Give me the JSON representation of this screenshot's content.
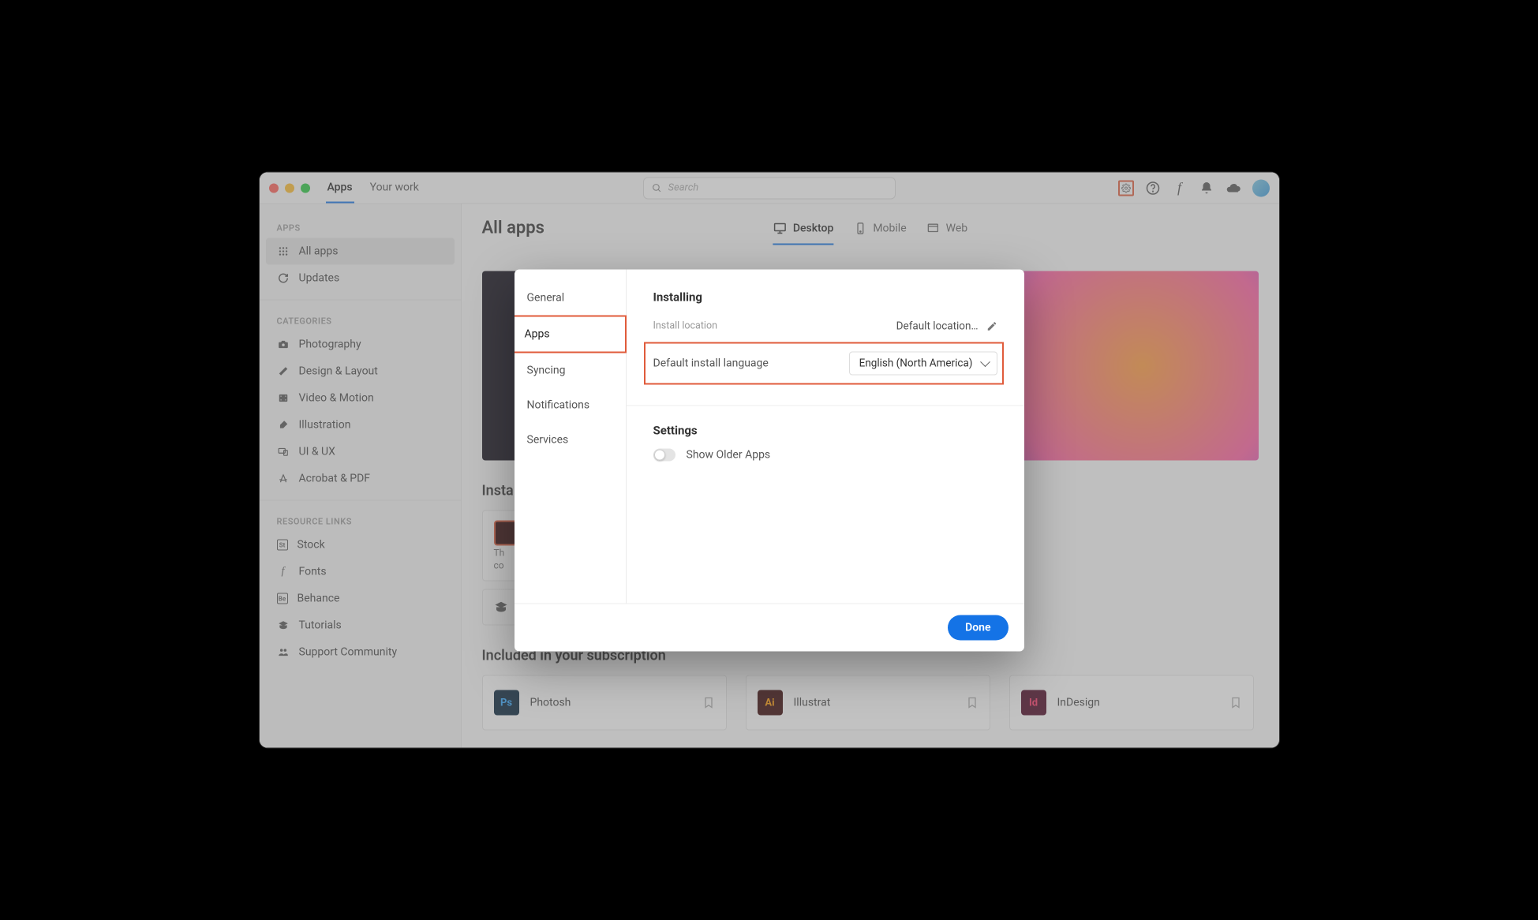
{
  "header": {
    "tabs": [
      "Apps",
      "Your work"
    ],
    "active_tab": 0,
    "search_placeholder": "Search"
  },
  "sidebar": {
    "sections": [
      {
        "title": "APPS",
        "items": [
          "All apps",
          "Updates"
        ],
        "active": 0
      },
      {
        "title": "CATEGORIES",
        "items": [
          "Photography",
          "Design & Layout",
          "Video & Motion",
          "Illustration",
          "UI & UX",
          "Acrobat & PDF"
        ]
      },
      {
        "title": "RESOURCE LINKS",
        "items": [
          "Stock",
          "Fonts",
          "Behance",
          "Tutorials",
          "Support Community"
        ]
      }
    ]
  },
  "main": {
    "title": "All apps",
    "view_tabs": [
      "Desktop",
      "Mobile",
      "Web"
    ],
    "view_active": 0,
    "section_installed": "Insta",
    "section_included": "Included in your subscription",
    "installed_desc_line1": "Th",
    "installed_desc_line2": "co",
    "apps": [
      {
        "code": "Ps",
        "name": "Photosh",
        "bg": "#001e36",
        "fg": "#31a8ff"
      },
      {
        "code": "Ai",
        "name": "Illustrat",
        "bg": "#330000",
        "fg": "#ff9a00"
      },
      {
        "code": "Id",
        "name": "InDesign",
        "bg": "#49021f",
        "fg": "#ff3366"
      }
    ]
  },
  "dialog": {
    "nav": [
      "General",
      "Apps",
      "Syncing",
      "Notifications",
      "Services"
    ],
    "nav_active": 1,
    "installing_title": "Installing",
    "install_location_label": "Install location",
    "install_location_value": "Default location…",
    "lang_label": "Default install language",
    "lang_value": "English (North America)",
    "settings_title": "Settings",
    "show_older_label": "Show Older Apps",
    "done_label": "Done"
  }
}
